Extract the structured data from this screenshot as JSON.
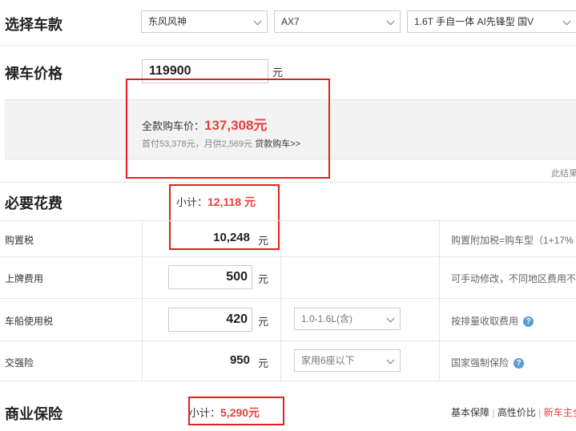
{
  "select_car": {
    "title": "选择车款",
    "brand": "东风风神",
    "model": "AX7",
    "trim": "1.6T 手自一体 AI先锋型 国V"
  },
  "bare_price": {
    "title": "裸车价格",
    "value": "119900",
    "unit": "元"
  },
  "summary": {
    "total_label": "全款购车价：",
    "total_value": "137,308元",
    "down_payment": "首付53,378元，月供2,569元",
    "loan_link": "贷款购车>>",
    "note_cut": "此结果"
  },
  "necessary": {
    "title": "必要花费",
    "subtotal_label": "小计：",
    "subtotal_value": "12,118 元",
    "rows": [
      {
        "label": "购置税",
        "value": "10,248",
        "unit": "元",
        "note": "购置附加税=购车型（1+17%"
      },
      {
        "label": "上牌费用",
        "value": "500",
        "unit": "元",
        "note": "可手动修改，不同地区费用不"
      },
      {
        "label": "车船使用税",
        "value": "420",
        "unit": "元",
        "option": "1.0-1.6L(含)",
        "note": "按排量收取费用"
      },
      {
        "label": "交强险",
        "value": "950",
        "unit": "元",
        "option": "家用6座以下",
        "note": "国家强制保险"
      }
    ]
  },
  "commercial": {
    "title": "商业保险",
    "subtotal_label": "小计：",
    "subtotal_value": "5,290元",
    "links": [
      "基本保障",
      "高性价比",
      "新车主全"
    ]
  },
  "colors": {
    "accent_red": "#e8413c",
    "highlight_box": "#e02020",
    "help_icon": "#5b9bd5"
  }
}
